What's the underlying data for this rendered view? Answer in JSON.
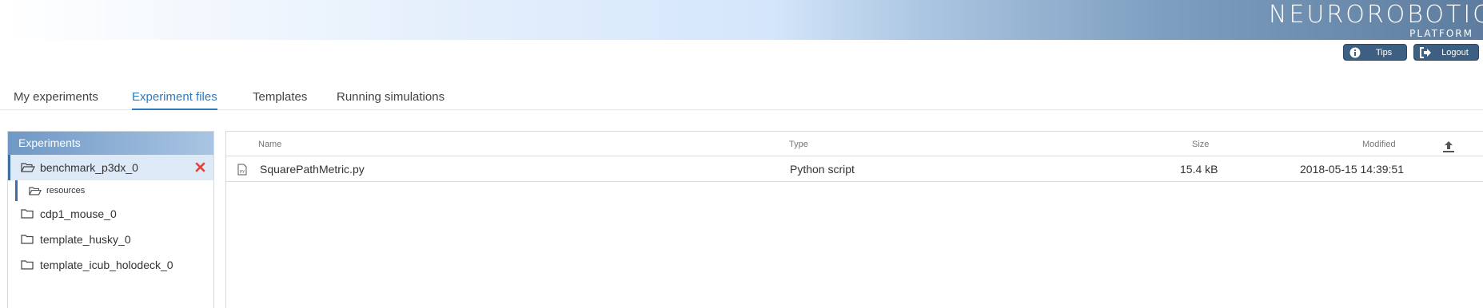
{
  "brand": {
    "name": "NEUROROBOTICS",
    "sub": "PLATFORM"
  },
  "header": {
    "tips_label": "Tips",
    "logout_label": "Logout"
  },
  "tabs": [
    {
      "label": "My experiments",
      "active": false
    },
    {
      "label": "Experiment files",
      "active": true
    },
    {
      "label": "Templates",
      "active": false
    },
    {
      "label": "Running simulations",
      "active": false
    }
  ],
  "sidebar": {
    "title": "Experiments",
    "items": [
      {
        "label": "benchmark_p3dx_0",
        "selected": true,
        "icon": "folder-open-icon"
      },
      {
        "label": "resources",
        "icon": "folder-open-icon"
      },
      {
        "label": "cdp1_mouse_0",
        "icon": "folder-icon"
      },
      {
        "label": "template_husky_0",
        "icon": "folder-icon"
      },
      {
        "label": "template_icub_holodeck_0",
        "icon": "folder-icon"
      }
    ]
  },
  "files": {
    "columns": {
      "name": "Name",
      "type": "Type",
      "size": "Size",
      "modified": "Modified"
    },
    "rows": [
      {
        "name": "SquarePathMetric.py",
        "type": "Python script",
        "size": "15.4 kB",
        "modified": "2018-05-15 14:39:51"
      }
    ]
  },
  "colors": {
    "accent": "#2f7abf",
    "button": "#3d5f82",
    "delete": "#e0413b"
  }
}
